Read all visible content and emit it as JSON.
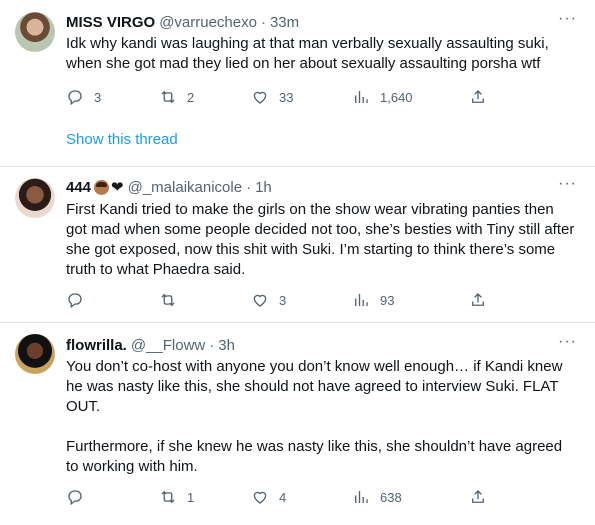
{
  "tweets": [
    {
      "name": "MISS VIRGO",
      "handle": "@varruechexo",
      "dot": "·",
      "time": "33m",
      "text": "Idk why kandi was laughing at that man verbally sexually assaulting suki, when she got mad they lied on her about sexually assaulting porsha wtf",
      "replies": "3",
      "retweets": "2",
      "likes": "33",
      "views": "1,640",
      "show_thread": "Show this thread"
    },
    {
      "name": "444",
      "handle": "@_malaikanicole",
      "dot": "·",
      "time": "1h",
      "emoji_heart": "❤",
      "text": "First Kandi tried to make the girls on the show wear vibrating panties then got mad when some people decided not too, she’s besties with Tiny still after she got exposed, now this shit with Suki. I’m starting to think there’s some truth to what Phaedra said.",
      "replies": "",
      "retweets": "",
      "likes": "3",
      "views": "93"
    },
    {
      "name": "flowrilla.",
      "handle": "@__Floww",
      "dot": "·",
      "time": "3h",
      "text_p1": "You don’t co-host with anyone you don’t know well enough… if Kandi knew he was nasty like this, she should not have agreed to interview Suki. FLAT OUT.",
      "text_p2": "Furthermore, if she knew he was nasty like this, she shouldn’t have agreed to working with him.",
      "replies": "",
      "retweets": "1",
      "likes": "4",
      "views": "638"
    }
  ],
  "more_label": "···",
  "icons": [
    "reply-icon",
    "retweet-icon",
    "like-icon",
    "views-icon",
    "share-icon"
  ]
}
